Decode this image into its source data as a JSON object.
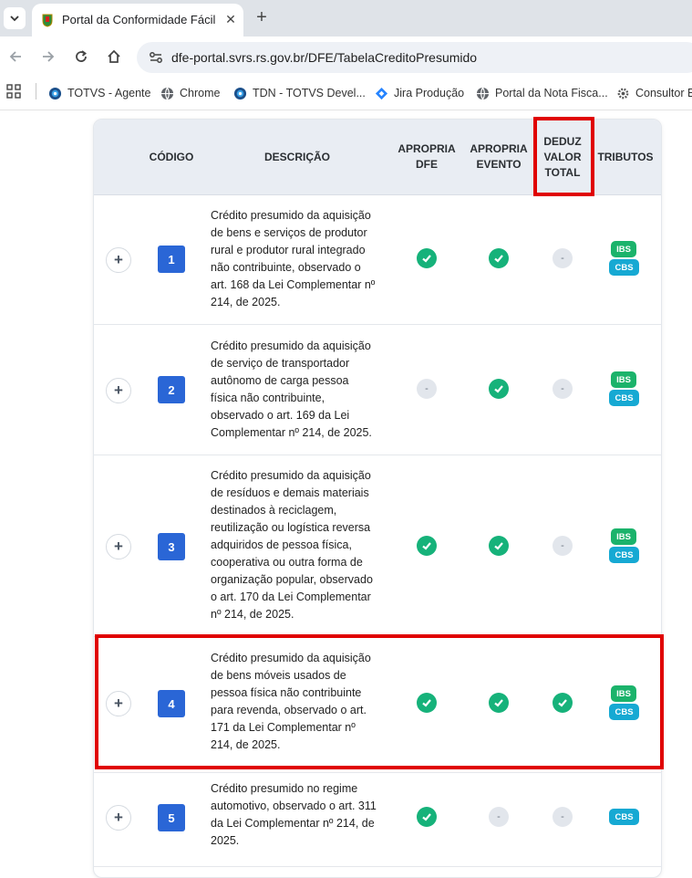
{
  "browser": {
    "tab_title": "Portal da Conformidade Fácil",
    "url": "dfe-portal.svrs.rs.gov.br/DFE/TabelaCreditoPresumido",
    "bookmarks": [
      {
        "label": "TOTVS - Agente",
        "icon": "globe-icon"
      },
      {
        "label": "Chrome",
        "icon": "globe-icon"
      },
      {
        "label": "TDN - TOTVS Devel...",
        "icon": "globe-icon"
      },
      {
        "label": "Jira Produção",
        "icon": "jira-icon"
      },
      {
        "label": "Portal da Nota Fisca...",
        "icon": "globe-icon"
      },
      {
        "label": "Consultor El",
        "icon": "gear-icon"
      }
    ]
  },
  "table": {
    "headers": {
      "codigo": "CÓDIGO",
      "descricao": "DESCRIÇÃO",
      "apropria_dfe": [
        "APROPRIA",
        "DFE"
      ],
      "apropria_evento": [
        "APROPRIA",
        "EVENTO"
      ],
      "deduz_valor_total": [
        "DEDUZ",
        "VALOR",
        "TOTAL"
      ],
      "tributos": "TRIBUTOS"
    },
    "rows": [
      {
        "code": "1",
        "description": [
          "Crédito presumido da aquisição",
          "de bens e serviços de produtor",
          "rural e produtor rural integrado",
          "não contribuinte, observado o",
          "art. 168 da Lei Complementar nº",
          "214, de 2025."
        ],
        "apropria_dfe": true,
        "apropria_evento": true,
        "deduz_valor_total": false,
        "tributos": [
          "IBS",
          "CBS"
        ]
      },
      {
        "code": "2",
        "description": [
          "Crédito presumido da aquisição",
          "de serviço de transportador",
          "autônomo de carga pessoa",
          "física não contribuinte,",
          "observado o art. 169 da Lei",
          "Complementar nº 214, de 2025."
        ],
        "apropria_dfe": false,
        "apropria_evento": true,
        "deduz_valor_total": false,
        "tributos": [
          "IBS",
          "CBS"
        ]
      },
      {
        "code": "3",
        "description": [
          "Crédito presumido da aquisição",
          "de resíduos e demais materiais",
          "destinados à reciclagem,",
          "reutilização ou logística reversa",
          "adquiridos de pessoa física,",
          "cooperativa ou outra forma de",
          "organização popular, observado",
          "o art. 170 da Lei Complementar",
          "nº 214, de 2025."
        ],
        "apropria_dfe": true,
        "apropria_evento": true,
        "deduz_valor_total": false,
        "tributos": [
          "IBS",
          "CBS"
        ]
      },
      {
        "code": "4",
        "description": [
          "Crédito presumido da aquisição",
          "de bens móveis usados de",
          "pessoa física não contribuinte",
          "para revenda, observado o art.",
          "171 da Lei Complementar nº",
          "214, de 2025."
        ],
        "apropria_dfe": true,
        "apropria_evento": true,
        "deduz_valor_total": true,
        "tributos": [
          "IBS",
          "CBS"
        ]
      },
      {
        "code": "5",
        "description": [
          "Crédito presumido no regime",
          "automotivo, observado o art. 311",
          "da Lei Complementar nº 214, de",
          "2025."
        ],
        "apropria_dfe": true,
        "apropria_evento": false,
        "deduz_valor_total": false,
        "tributos": [
          "CBS"
        ]
      }
    ],
    "dash_symbol": "-",
    "expand_symbol": "+"
  },
  "colors": {
    "highlight": "#e00000",
    "code_badge": "#2a66d6",
    "check": "#16b27a",
    "ibs": "#1bb36b",
    "cbs": "#16a9d3"
  }
}
